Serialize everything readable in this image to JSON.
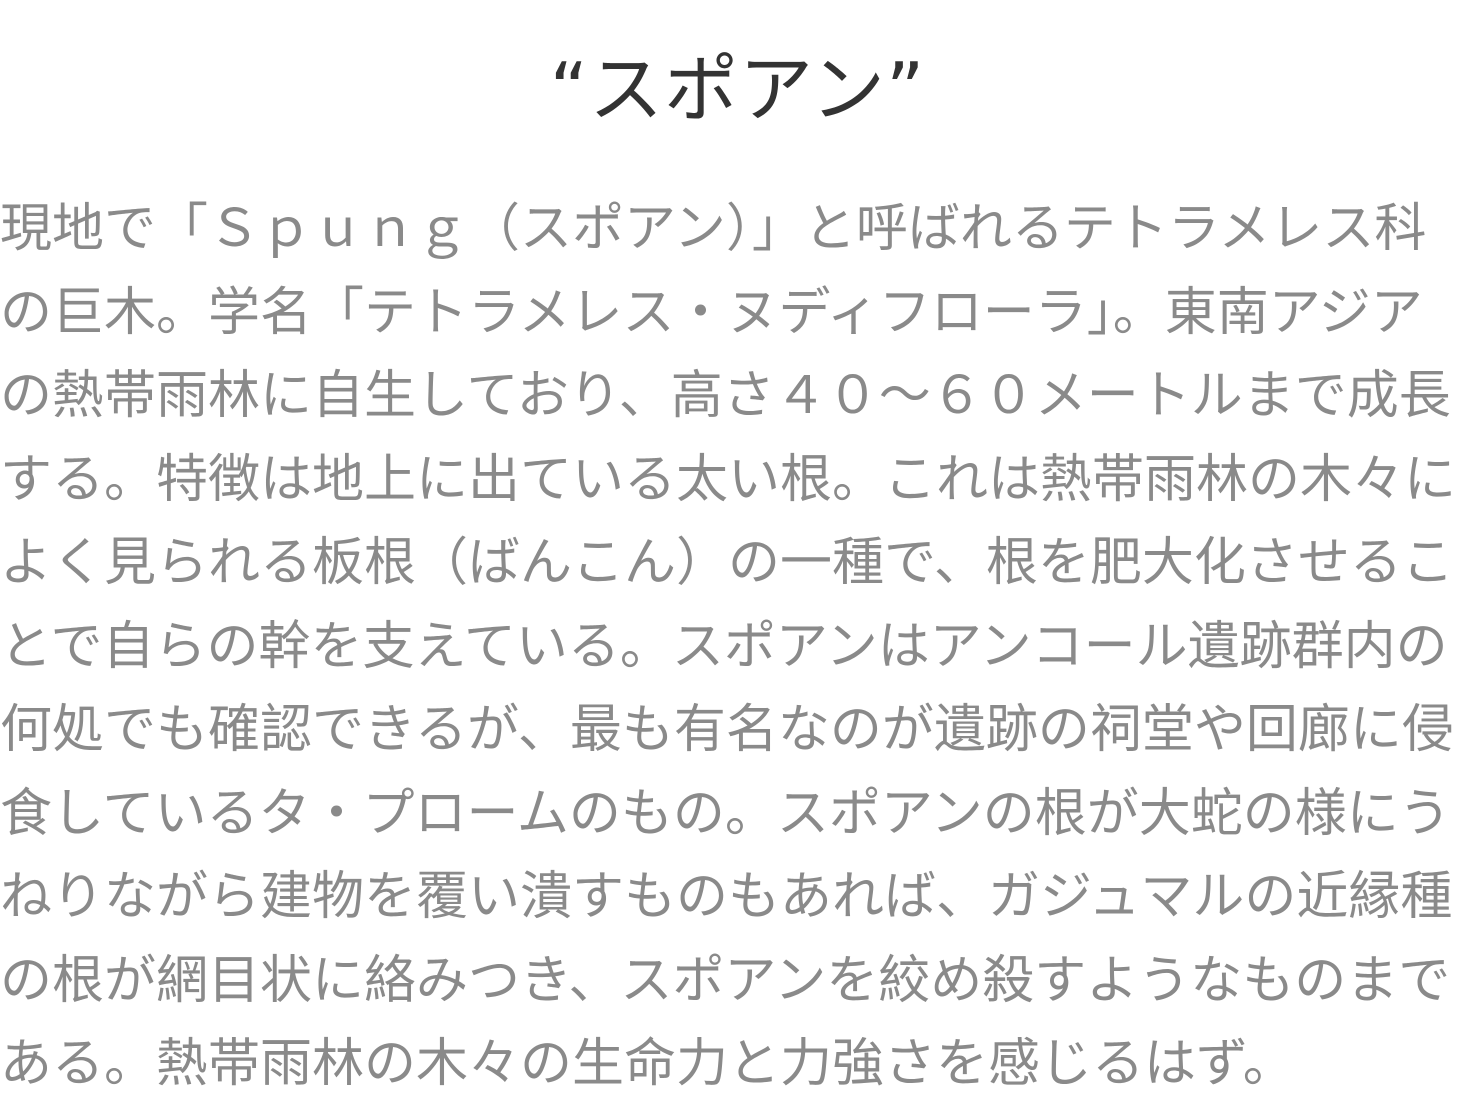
{
  "article": {
    "title": "“スポアン”",
    "lines": [
      "現地で「Ｓｐｕｎｇ（スポアン）」と呼ばれるテトラメレス科",
      "の巨木。学名「テトラメレス・ヌディフローラ」。東南アジア",
      "の熱帯雨林に自生しており、高さ４０～６０メートルまで成長",
      "する。特徴は地上に出ている太い根。これは熱帯雨林の木々に",
      "よく見られる板根（ばんこん）の一種で、根を肥大化させるこ",
      "とで自らの幹を支えている。スポアンはアンコール遺跡群内の",
      "何処でも確認できるが、最も有名なのが遺跡の祠堂や回廊に侵",
      "食しているタ・プロームのもの。スポアンの根が大蛇の様にう",
      "ねりながら建物を覆い潰すものもあれば、ガジュマルの近縁種",
      "の根が網目状に絡みつき、スポアンを絞め殺すようなものまで",
      "ある。熱帯雨林の木々の生命力と力強さを感じるはず。"
    ]
  }
}
